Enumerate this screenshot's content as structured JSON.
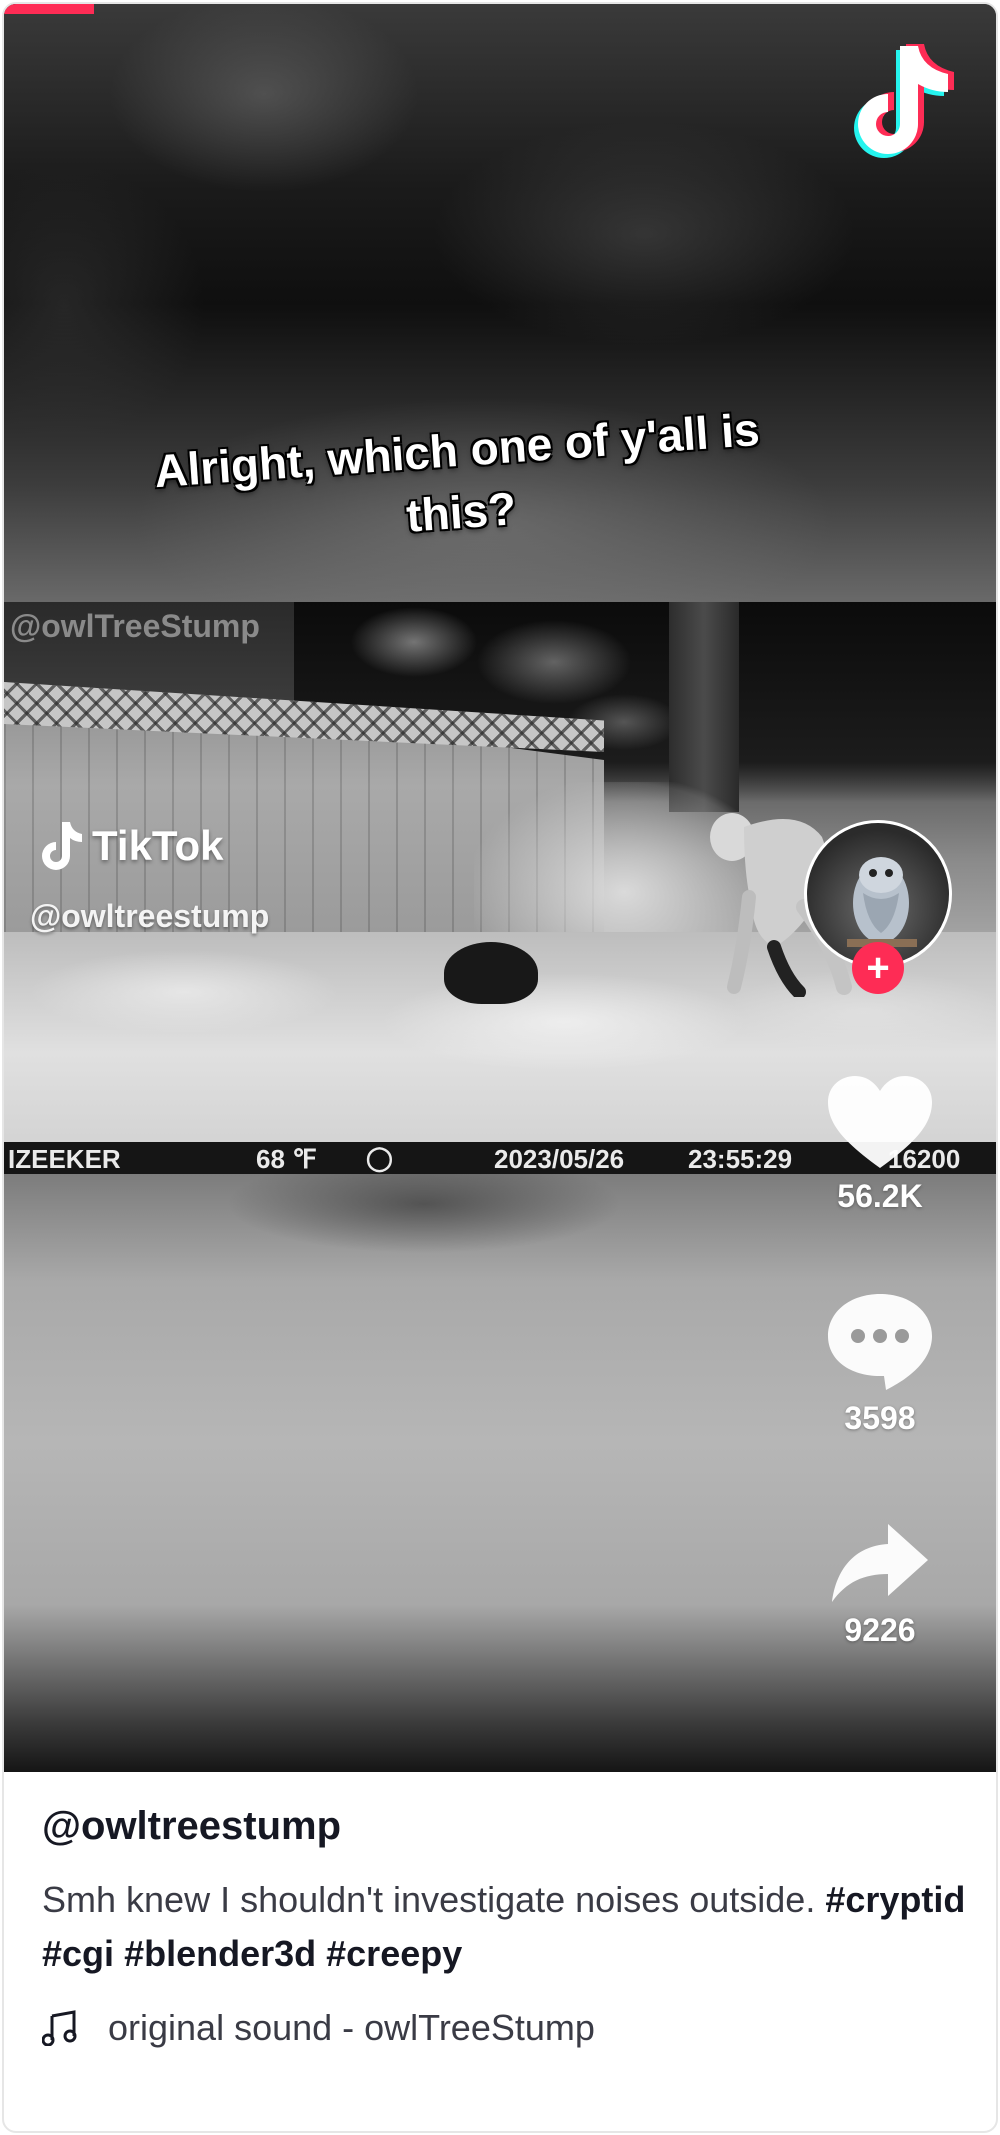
{
  "video": {
    "caption_line1": "Alright, which one of y'all is",
    "caption_line2": "this?",
    "camera_watermark": "@owlTreeStump",
    "tiktok_mark": "TikTok",
    "tiktok_handle": "@owltreestump",
    "camera_overlay": {
      "brand": "IZEEKER",
      "temp": "68 ℉",
      "date": "2023/05/26",
      "time": "23:55:29",
      "id": "16200"
    },
    "progress_color": "#fe2c55"
  },
  "actions": {
    "likes": "56.2K",
    "comments": "3598",
    "shares": "9226",
    "follow_label": "+"
  },
  "post": {
    "author": "@owltreestump",
    "description": "Smh knew I shouldn't investigate noises outside.",
    "hashtags": [
      "#cryptid",
      "#cgi",
      "#blender3d",
      "#creepy"
    ],
    "sound": "original sound - owlTreeStump"
  },
  "icons": [
    "tiktok-logo-icon",
    "heart-icon",
    "comment-icon",
    "share-icon",
    "music-note-icon"
  ],
  "colors": {
    "accent": "#fe2c55",
    "cyan": "#25f4ee",
    "text": "#161823"
  }
}
